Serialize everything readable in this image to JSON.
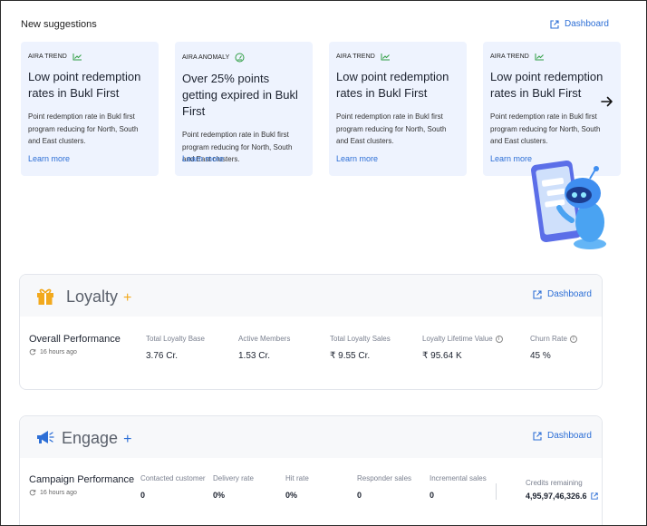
{
  "suggestions": {
    "title": "New suggestions",
    "dashboard_label": "Dashboard",
    "cards": [
      {
        "tag": "AIRA TREND",
        "tag_icon": "trend-icon",
        "title": "Low point redemption rates in Bukl First",
        "body": "Point redemption rate in Bukl first program reducing for North, South and East clusters.",
        "link": "Learn more"
      },
      {
        "tag": "AIRA ANOMALY",
        "tag_icon": "anomaly-gauge-icon",
        "title": "Over 25% points getting expired in Bukl First",
        "body": "Point redemption rate in Bukl first program reducing for North, South and East clusters.",
        "link": "Learn more"
      },
      {
        "tag": "AIRA TREND",
        "tag_icon": "trend-icon",
        "title": "Low point redemption rates in Bukl First",
        "body": "Point redemption rate in Bukl first program reducing for North, South and East clusters.",
        "link": "Learn more"
      },
      {
        "tag": "AIRA TREND",
        "tag_icon": "trend-icon",
        "title": "Low point redemption rates in Bukl First",
        "body": "Point redemption rate in Bukl first program reducing for North, South and East clusters.",
        "link": "Learn more"
      }
    ]
  },
  "loyalty": {
    "name": "Loyalty",
    "plus": "+",
    "dashboard_label": "Dashboard",
    "perf_title": "Overall Performance",
    "updated": "16 hours ago",
    "metrics": [
      {
        "label": "Total Loyalty Base",
        "value": "3.76 Cr."
      },
      {
        "label": "Active Members",
        "value": "1.53 Cr."
      },
      {
        "label": "Total Loyalty Sales",
        "value": "₹ 9.55 Cr."
      },
      {
        "label": "Loyalty Lifetime Value",
        "value": "₹ 95.64 K"
      },
      {
        "label": "Churn Rate",
        "value": "45 %"
      }
    ]
  },
  "engage": {
    "name": "Engage",
    "plus": "+",
    "dashboard_label": "Dashboard",
    "perf_title": "Campaign Performance",
    "updated": "16 hours ago",
    "metrics": [
      {
        "label": "Contacted customer",
        "value": "0"
      },
      {
        "label": "Delivery rate",
        "value": "0%"
      },
      {
        "label": "Hit rate",
        "value": "0%"
      },
      {
        "label": "Responder sales",
        "value": "0"
      },
      {
        "label": "Incremental sales",
        "value": "0"
      }
    ],
    "credits_label": "Credits remaining",
    "credits_value": "4,95,97,46,326.6"
  },
  "colors": {
    "accent": "#2d6fd6",
    "card_bg": "#eef3fe",
    "trend_green": "#2f9e44",
    "loyalty_gold": "#f2a91d"
  }
}
